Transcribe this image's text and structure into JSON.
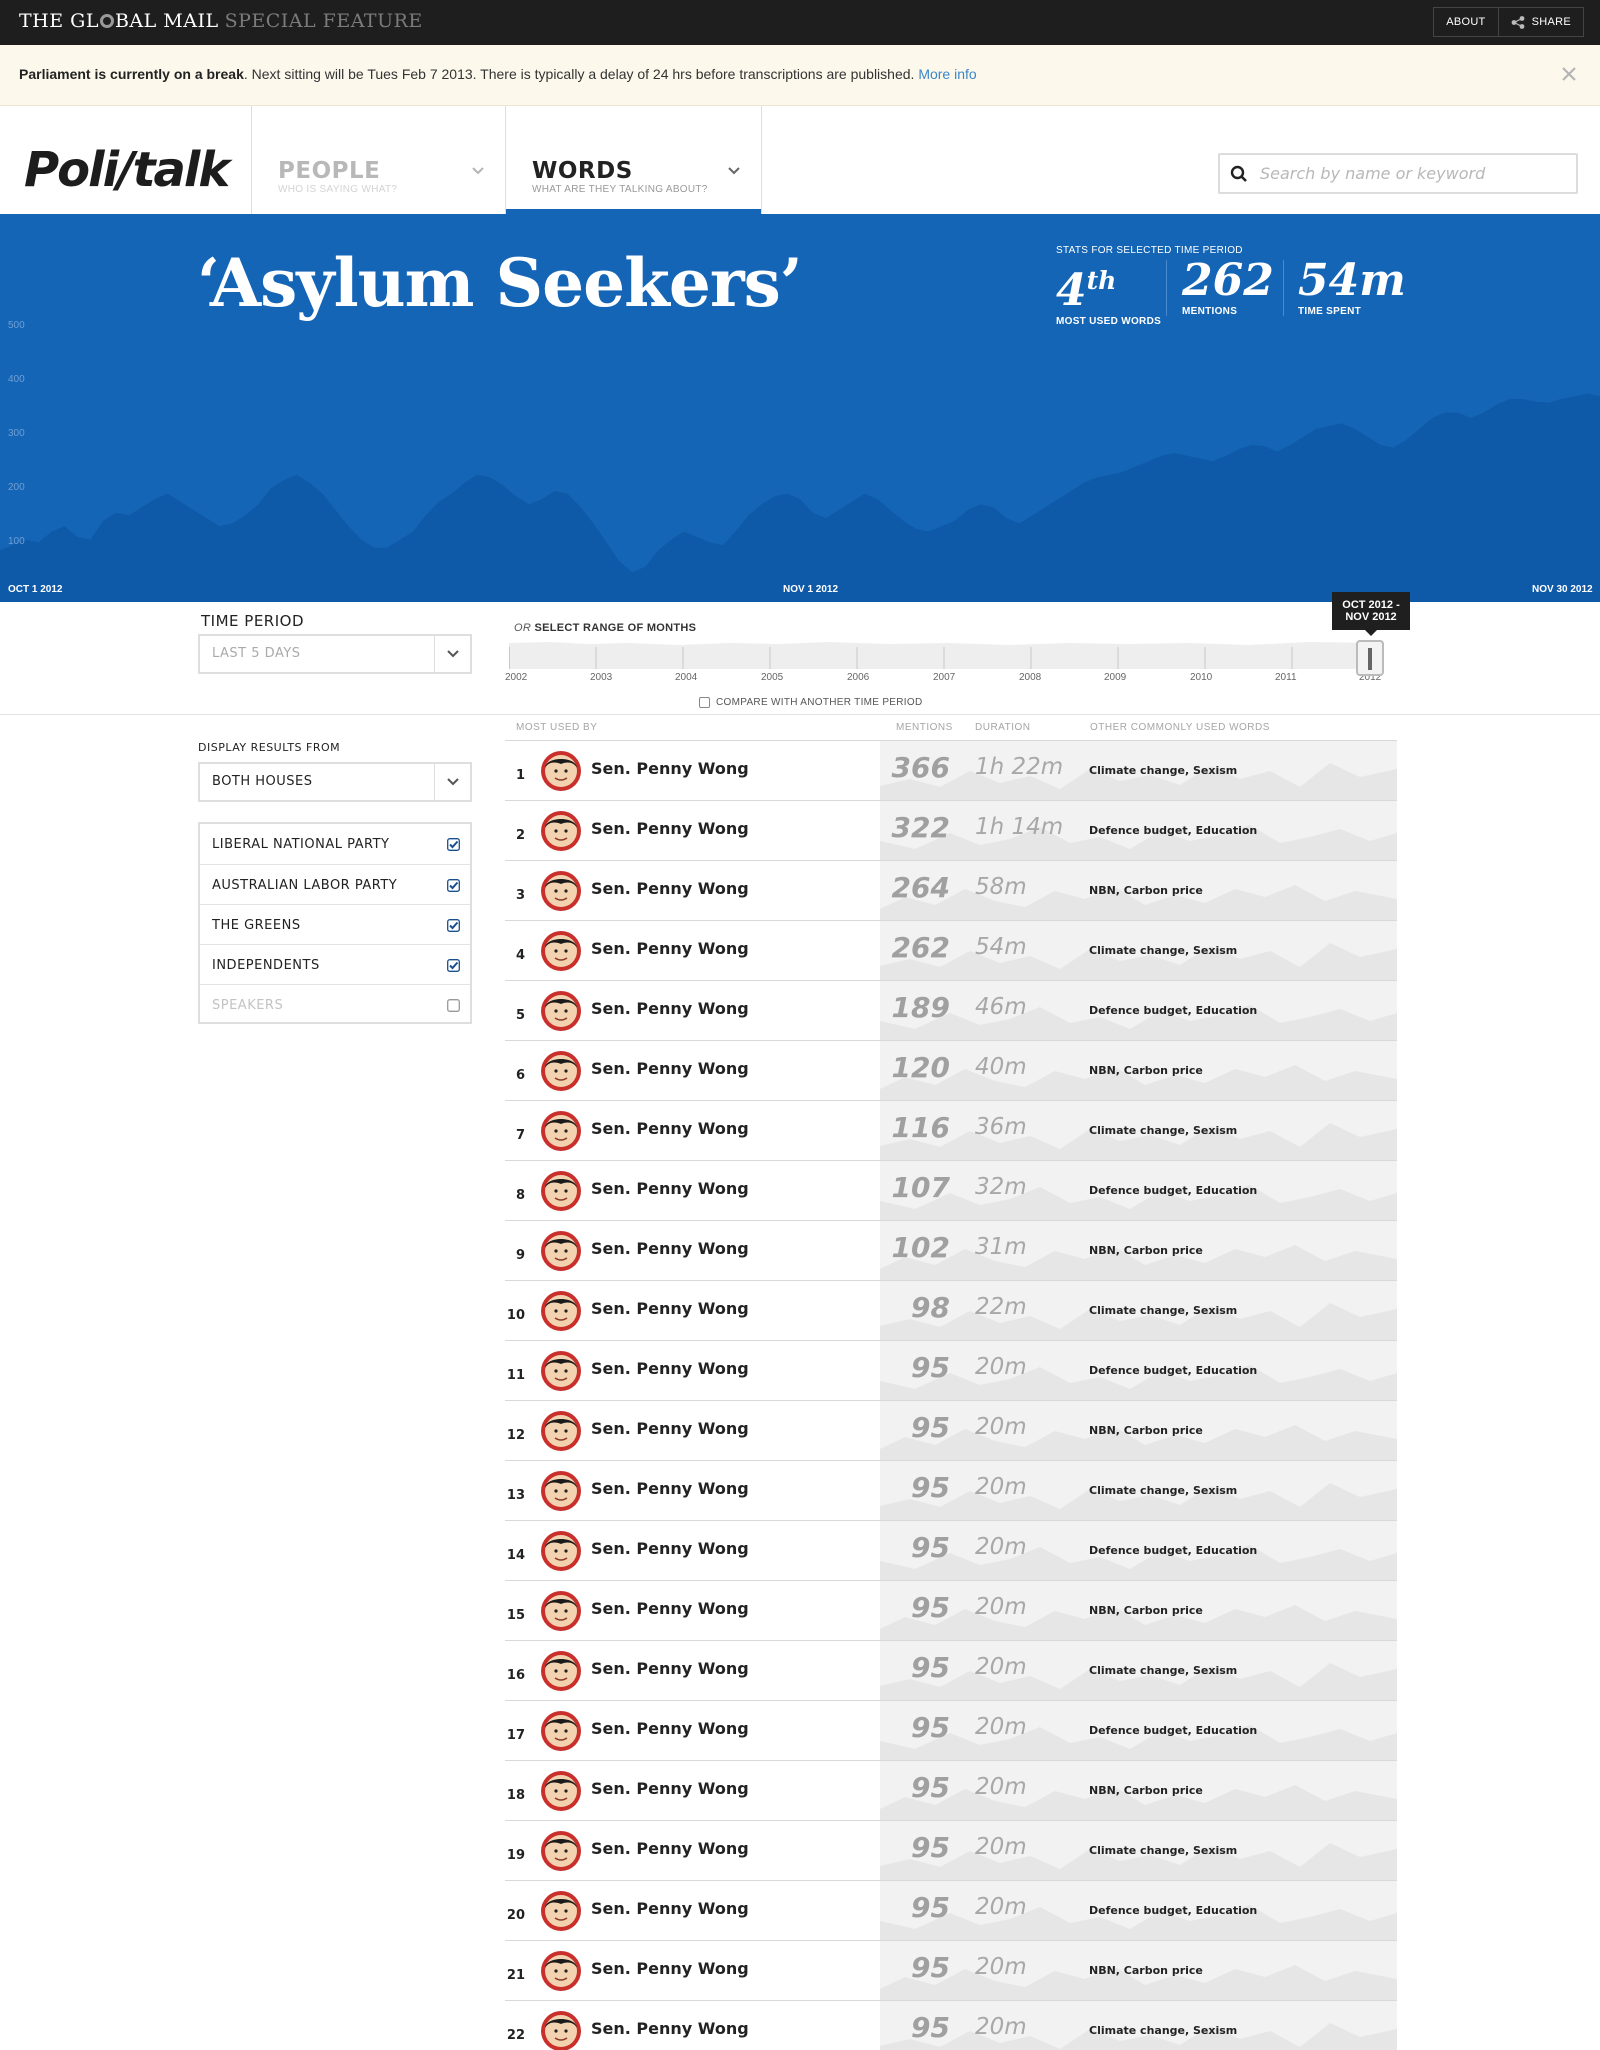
{
  "site": {
    "brand": {
      "part1": "THE GL",
      "part2": "BAL MAIL",
      "special": "SPECIAL FEATURE"
    },
    "about_label": "ABOUT",
    "share_label": "SHARE"
  },
  "notice": {
    "bold": "Parliament is currently on a break",
    "text": ". Next sitting will be Tues Feb 7 2013. There is typically a delay of 24 hrs before transcriptions are published.",
    "link": "More info"
  },
  "nav": {
    "logo": "Poli/talk",
    "tabs": [
      {
        "title": "PEOPLE",
        "sub": "WHO IS SAYING WHAT?"
      },
      {
        "title": "WORDS",
        "sub": "WHAT ARE THEY TALKING ABOUT?"
      }
    ],
    "search_placeholder": "Search by name or keyword"
  },
  "hero": {
    "title": "‘Asylum Seekers’",
    "stats_caption": "STATS FOR SELECTED TIME PERIOD",
    "stats": [
      {
        "value": "4",
        "suffix": "th",
        "label": "MOST USED WORDS"
      },
      {
        "value": "262",
        "suffix": "",
        "label": "MENTIONS"
      },
      {
        "value": "54m",
        "suffix": "",
        "label": "TIME SPENT"
      }
    ]
  },
  "chart_data": {
    "type": "area",
    "y_ticks": [
      "500",
      "400",
      "300",
      "200",
      "100"
    ],
    "ylim": [
      0,
      520
    ],
    "x_labels": [
      "OCT 1 2012",
      "NOV 1 2012",
      "NOV 30 2012"
    ],
    "values": [
      75,
      85,
      95,
      90,
      110,
      120,
      100,
      95,
      130,
      145,
      140,
      155,
      170,
      180,
      165,
      150,
      135,
      120,
      125,
      140,
      160,
      190,
      205,
      215,
      200,
      180,
      150,
      120,
      95,
      80,
      80,
      95,
      110,
      140,
      165,
      180,
      200,
      215,
      210,
      195,
      175,
      160,
      170,
      185,
      180,
      155,
      125,
      90,
      55,
      35,
      45,
      75,
      95,
      110,
      100,
      90,
      85,
      110,
      140,
      160,
      175,
      180,
      170,
      145,
      135,
      150,
      165,
      180,
      170,
      150,
      130,
      115,
      110,
      120,
      130,
      150,
      160,
      155,
      135,
      125,
      140,
      155,
      170,
      185,
      200,
      210,
      215,
      220,
      230,
      240,
      250,
      255,
      250,
      245,
      240,
      250,
      262,
      270,
      268,
      258,
      270,
      285,
      300,
      305,
      310,
      300,
      285,
      270,
      265,
      280,
      300,
      320,
      330,
      330,
      320,
      330,
      345,
      355,
      355,
      350,
      348,
      355,
      360,
      365,
      360
    ]
  },
  "period": {
    "label": "TIME PERIOD",
    "selected": "LAST 5 DAYS",
    "range_or": "OR",
    "range_label": "SELECT RANGE OF MONTHS",
    "years": [
      "2002",
      "2003",
      "2004",
      "2005",
      "2006",
      "2007",
      "2008",
      "2009",
      "2010",
      "2011",
      "2012"
    ],
    "tip_line1": "OCT 2012 -",
    "tip_line2": "NOV 2012",
    "compare_label": "COMPARE WITH ANOTHER TIME PERIOD"
  },
  "filters": {
    "display_label": "DISPLAY RESULTS FROM",
    "house": "BOTH HOUSES",
    "parties": [
      {
        "label": "LIBERAL NATIONAL PARTY",
        "checked": true
      },
      {
        "label": "AUSTRALIAN LABOR PARTY",
        "checked": true
      },
      {
        "label": "THE GREENS",
        "checked": true
      },
      {
        "label": "INDEPENDENTS",
        "checked": true
      },
      {
        "label": "SPEAKERS",
        "checked": false
      }
    ]
  },
  "table": {
    "headers": [
      "MOST USED BY",
      "MENTIONS",
      "DURATION",
      "OTHER COMMONLY USED WORDS"
    ],
    "rows": [
      {
        "rank": "1",
        "name": "Sen. Penny Wong",
        "mentions": "366",
        "duration": "1h 22m",
        "others": "Climate change, Sexism"
      },
      {
        "rank": "2",
        "name": "Sen. Penny Wong",
        "mentions": "322",
        "duration": "1h 14m",
        "others": "Defence budget, Education"
      },
      {
        "rank": "3",
        "name": "Sen. Penny Wong",
        "mentions": "264",
        "duration": "58m",
        "others": "NBN, Carbon price"
      },
      {
        "rank": "4",
        "name": "Sen. Penny Wong",
        "mentions": "262",
        "duration": "54m",
        "others": "Climate change, Sexism"
      },
      {
        "rank": "5",
        "name": "Sen. Penny Wong",
        "mentions": "189",
        "duration": "46m",
        "others": "Defence budget, Education"
      },
      {
        "rank": "6",
        "name": "Sen. Penny Wong",
        "mentions": "120",
        "duration": "40m",
        "others": "NBN, Carbon price"
      },
      {
        "rank": "7",
        "name": "Sen. Penny Wong",
        "mentions": "116",
        "duration": "36m",
        "others": "Climate change, Sexism"
      },
      {
        "rank": "8",
        "name": "Sen. Penny Wong",
        "mentions": "107",
        "duration": "32m",
        "others": "Defence budget, Education"
      },
      {
        "rank": "9",
        "name": "Sen. Penny Wong",
        "mentions": "102",
        "duration": "31m",
        "others": "NBN, Carbon price"
      },
      {
        "rank": "10",
        "name": "Sen. Penny Wong",
        "mentions": "98",
        "duration": "22m",
        "others": "Climate change, Sexism"
      },
      {
        "rank": "11",
        "name": "Sen. Penny Wong",
        "mentions": "95",
        "duration": "20m",
        "others": "Defence budget, Education"
      },
      {
        "rank": "12",
        "name": "Sen. Penny Wong",
        "mentions": "95",
        "duration": "20m",
        "others": "NBN, Carbon price"
      },
      {
        "rank": "13",
        "name": "Sen. Penny Wong",
        "mentions": "95",
        "duration": "20m",
        "others": "Climate change, Sexism"
      },
      {
        "rank": "14",
        "name": "Sen. Penny Wong",
        "mentions": "95",
        "duration": "20m",
        "others": "Defence budget, Education"
      },
      {
        "rank": "15",
        "name": "Sen. Penny Wong",
        "mentions": "95",
        "duration": "20m",
        "others": "NBN, Carbon price"
      },
      {
        "rank": "16",
        "name": "Sen. Penny Wong",
        "mentions": "95",
        "duration": "20m",
        "others": "Climate change, Sexism"
      },
      {
        "rank": "17",
        "name": "Sen. Penny Wong",
        "mentions": "95",
        "duration": "20m",
        "others": "Defence budget, Education"
      },
      {
        "rank": "18",
        "name": "Sen. Penny Wong",
        "mentions": "95",
        "duration": "20m",
        "others": "NBN, Carbon price"
      },
      {
        "rank": "19",
        "name": "Sen. Penny Wong",
        "mentions": "95",
        "duration": "20m",
        "others": "Climate change, Sexism"
      },
      {
        "rank": "20",
        "name": "Sen. Penny Wong",
        "mentions": "95",
        "duration": "20m",
        "others": "Defence budget, Education"
      },
      {
        "rank": "21",
        "name": "Sen. Penny Wong",
        "mentions": "95",
        "duration": "20m",
        "others": "NBN, Carbon price"
      },
      {
        "rank": "22",
        "name": "Sen. Penny Wong",
        "mentions": "95",
        "duration": "20m",
        "others": "Climate change, Sexism"
      }
    ]
  },
  "colors": {
    "accent": "#1565b7",
    "area": "#0f5aa8",
    "checkbox": "#1a4f8c",
    "avatar_ring": "#c9302c"
  }
}
